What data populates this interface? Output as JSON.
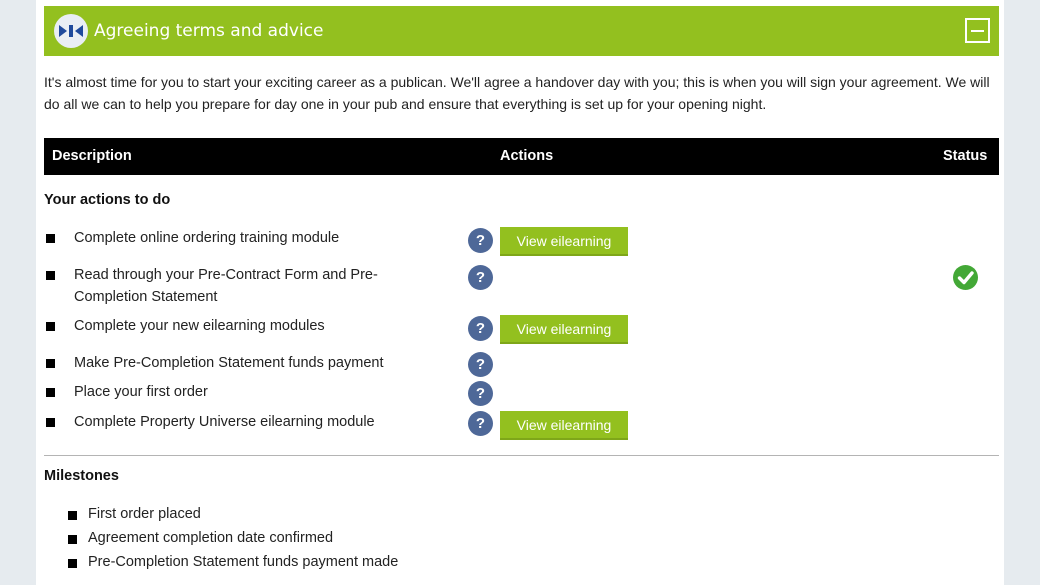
{
  "panel": {
    "title": "Agreeing terms and advice",
    "intro": "It's almost time for you to start your exciting career as a publican. We'll agree a handover day with you; this is when you will sign your agreement. We will do all we can to help you prepare for day one in your pub and ensure that everything is set up for your opening night."
  },
  "table": {
    "headers": {
      "description": "Description",
      "actions": "Actions",
      "status": "Status"
    }
  },
  "actions_section": {
    "title": "Your actions to do",
    "help_symbol": "?",
    "items": [
      {
        "text": "Complete online ordering training module",
        "button": "View eilearning",
        "complete": false
      },
      {
        "text": "Read through your Pre-Contract Form and Pre-Completion Statement",
        "button": "",
        "complete": true
      },
      {
        "text": "Complete your new eilearning modules",
        "button": "View eilearning",
        "complete": false
      },
      {
        "text": "Make Pre-Completion Statement funds payment",
        "button": "",
        "complete": false
      },
      {
        "text": "Place your first order",
        "button": "",
        "complete": false
      },
      {
        "text": "Complete Property Universe eilearning module",
        "button": "View eilearning",
        "complete": false
      }
    ]
  },
  "milestones": {
    "title": "Milestones",
    "items": [
      "First order placed",
      "Agreement completion date confirmed",
      "Pre-Completion Statement funds payment made"
    ]
  },
  "colors": {
    "accent_green": "#93c01f",
    "help_blue": "#4e6898",
    "status_green": "#43a836",
    "header_black": "#000000"
  },
  "icons": {
    "logo": "company-logo-icon",
    "collapse": "minus-square-icon",
    "help": "question-circle-icon",
    "status": "check-circle-icon"
  }
}
